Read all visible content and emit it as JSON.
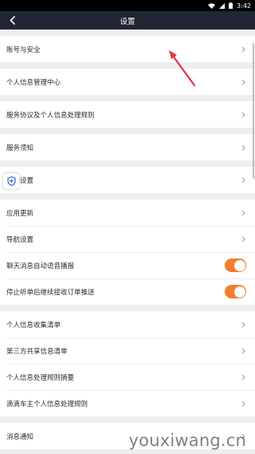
{
  "status_bar": {
    "time": "3:42"
  },
  "header": {
    "title": "设置"
  },
  "groups": [
    {
      "items": [
        {
          "label": "账号与安全"
        }
      ]
    },
    {
      "items": [
        {
          "label": "个人信息管理中心"
        }
      ]
    },
    {
      "items": [
        {
          "label": "服务协议及个人信息处理规则"
        }
      ]
    },
    {
      "items": [
        {
          "label": "服务须知"
        }
      ]
    },
    {
      "items": [
        {
          "label": "地址设置"
        }
      ]
    },
    {
      "items": [
        {
          "label": "应用更新"
        },
        {
          "label": "导航设置"
        },
        {
          "label": "聊天消息自动语音播报",
          "toggle_on": true
        },
        {
          "label": "停止听单后继续接收订单推送",
          "toggle_on": true
        }
      ]
    },
    {
      "items": [
        {
          "label": "个人信息收集清单"
        },
        {
          "label": "第三方共享信息清单"
        },
        {
          "label": "个人信息处理规则摘要"
        },
        {
          "label": "滴滴车主个人信息处理规则"
        }
      ]
    },
    {
      "items": [
        {
          "label": "消息通知"
        }
      ]
    }
  ],
  "watermark": "youxiwang.cn",
  "colors": {
    "header_bg": "#1f2533",
    "toggle_on": "#f27e2e",
    "annotation_arrow": "#e8333a"
  },
  "icons": {
    "back": "chevron-left-icon",
    "row_arrow": "chevron-right-icon",
    "float": "shield-plus-icon"
  }
}
